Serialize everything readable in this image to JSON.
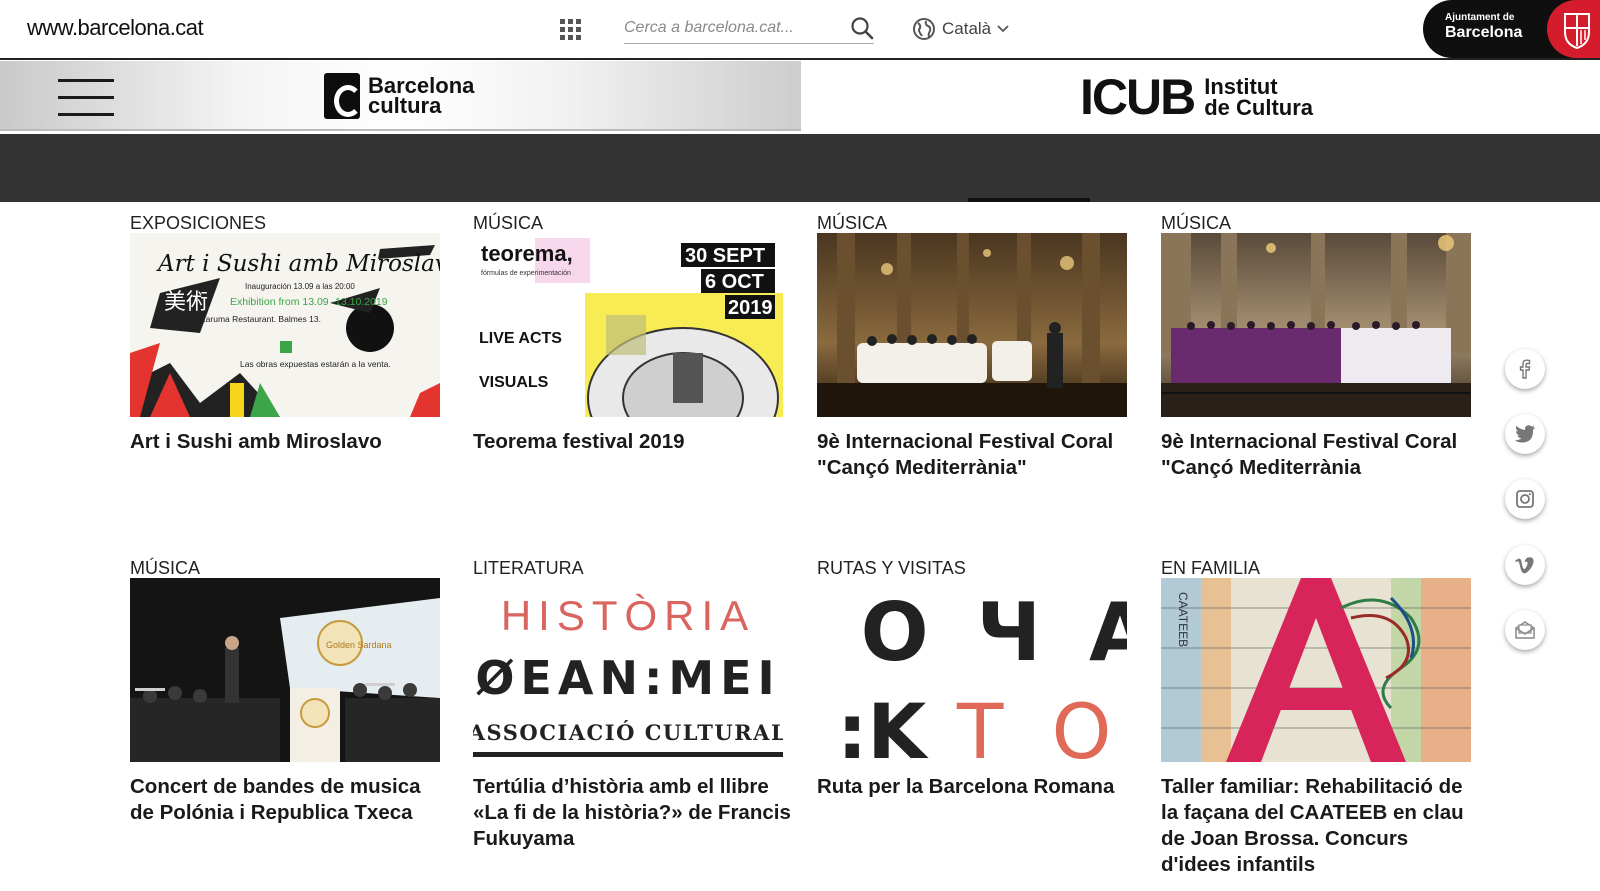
{
  "header": {
    "site_url": "www.barcelona.cat",
    "search_placeholder": "Cerca a barcelona.cat...",
    "language": "Català",
    "ajuntament_small": "Ajuntament de",
    "ajuntament_big": "Barcelona"
  },
  "brand": {
    "bc_line1": "Barcelona",
    "bc_line2": "cultura",
    "icub_big": "ICUB",
    "icub_line1": "Institut",
    "icub_line2": "de Cultura"
  },
  "cards": [
    {
      "category": "EXPOSICIONES",
      "title": "Art i Sushi amb Miroslavo",
      "poster": {
        "headline": "Art i Sushi amb Miroslavo",
        "line1": "Inauguración 13.09 a las 20:00",
        "line2": "Exhibition from 13.09 -13.10.2019",
        "line3": "Karuma Restaurant. Balmes 13.",
        "line4": "Las obras expuestas estarán a la venta.",
        "kanji": "美術"
      }
    },
    {
      "category": "MÚSICA",
      "title": "Teorema festival 2019",
      "poster": {
        "brand": "teorema,",
        "sub": "fórmulas de experimentación",
        "date1": "30 SEPT",
        "date2": "6 OCT",
        "date3": "2019",
        "live": "LIVE ACTS",
        "visuals": "VISUALS"
      }
    },
    {
      "category": "MÚSICA",
      "title": "9è Internacional Festival Coral \"Cançó Mediterrània\""
    },
    {
      "category": "MÚSICA",
      "title": "9è Internacional Festival Coral \"Cançó Mediterrània"
    },
    {
      "category": "MÚSICA",
      "title": "Concert de bandes de musica de Polónia i Republica Txeca",
      "poster": {
        "banner": "Golden Sardana"
      }
    },
    {
      "category": "LITERATURA",
      "title": "Tertúlia d’història amb el llibre «La fi de la història?» de Francis Fukuyama",
      "poster": {
        "word": "HISTÒRIA",
        "glyphs": "ØΕΑΝ:ΜΕΙ",
        "assoc": "ASSOCIACIÓ CULTURAL"
      }
    },
    {
      "category": "RUTAS Y VISITAS",
      "title": "Ruta per la Barcelona Romana",
      "poster": {
        "line1": "I O Ч A",
        "line2a": ":K",
        "line2b": "T O"
      }
    },
    {
      "category": "EN FAMILIA",
      "title": "Taller familiar: Rehabilitació de la façana del CAATEEB en clau de Joan Brossa. Concurs d'idees infantils",
      "poster": {
        "vertical": "CAATEEB"
      }
    }
  ],
  "social": [
    "facebook-icon",
    "twitter-icon",
    "instagram-icon",
    "vimeo-icon",
    "newsletter-icon"
  ],
  "colors": {
    "dark_strip": "#333333",
    "ajuntament_red": "#d41c2d",
    "text": "#1a1a1a"
  }
}
